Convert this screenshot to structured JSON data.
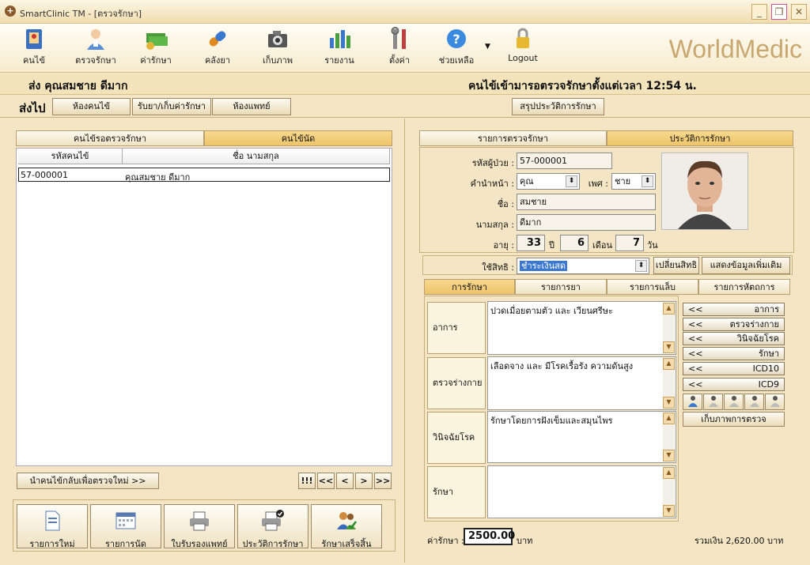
{
  "window": {
    "title": "SmartClinic TM - [ตรวจรักษา]"
  },
  "toolbar": {
    "items": [
      {
        "label": "คนไข้",
        "icon": "patient-book-icon"
      },
      {
        "label": "ตรวจรักษา",
        "icon": "doctor-icon"
      },
      {
        "label": "ค่ารักษา",
        "icon": "money-icon"
      },
      {
        "label": "คลังยา",
        "icon": "pill-icon"
      },
      {
        "label": "เก็บภาพ",
        "icon": "camera-icon"
      },
      {
        "label": "รายงาน",
        "icon": "bar-chart-icon"
      },
      {
        "label": "ตั้งค่า",
        "icon": "tools-icon"
      },
      {
        "label": "ช่วยเหลือ",
        "icon": "help-icon"
      },
      {
        "label": "Logout",
        "icon": "lock-icon"
      }
    ],
    "brand": "WorldMedic"
  },
  "status": {
    "patient": "ส่ง  คุณสมชาย ดีมาก",
    "since": "คนไข้เข้ามารอตรวจรักษาตั้งแต่เวลา 12:54 น."
  },
  "sendto": {
    "label": "ส่งไป",
    "buttons": [
      "ห้องคนไข้",
      "รับยา/เก็บค่ารักษา",
      "ห้องแพทย์"
    ],
    "summary": "สรุปประวัติการรักษา"
  },
  "left": {
    "tabs": [
      "คนไข้รอตรวจรักษา",
      "คนไข้นัด"
    ],
    "columns": [
      "รหัสคนไข้",
      "ชื่อ นามสกุล"
    ],
    "rows": [
      {
        "id": "57-000001",
        "name": "คุณสมชาย ดีมาก"
      }
    ],
    "return_button": "นำคนไข้กลับเพื่อตรวจใหม่ >>",
    "nav": [
      "!!!",
      "<<",
      "<",
      ">",
      ">>"
    ],
    "bottom_buttons": [
      {
        "label": "รายการใหม่",
        "icon": "new-document-icon"
      },
      {
        "label": "รายการนัด",
        "icon": "calendar-icon"
      },
      {
        "label": "ใบรับรองแพทย์",
        "icon": "printer-icon"
      },
      {
        "label": "ประวัติการรักษา",
        "icon": "printer-check-icon"
      },
      {
        "label": "รักษาเสร็จสิ้น",
        "icon": "users-check-icon"
      }
    ]
  },
  "right": {
    "tabs": [
      "รายการตรวจรักษา",
      "ประวัติการรักษา"
    ],
    "patient": {
      "id_label": "รหัสผู้ป่วย :",
      "id": "57-000001",
      "prefix_label": "คำนำหน้า :",
      "prefix": "คุณ",
      "gender_label": "เพศ :",
      "gender": "ชาย",
      "first_label": "ชื่อ :",
      "first": "สมชาย",
      "last_label": "นามสกุล :",
      "last": "ดีมาก",
      "age_label": "อายุ :",
      "age_years": "33",
      "years_unit": "ปี",
      "age_months": "6",
      "months_unit": "เดือน",
      "age_days": "7",
      "days_unit": "วัน"
    },
    "rights": {
      "label": "ใช้สิทธิ :",
      "value": "ชำระเงินสด",
      "change": "เปลี่ยนสิทธิ",
      "more": "แสดงข้อมูลเพิ่มเติม"
    },
    "subtabs": [
      "การรักษา",
      "รายการยา",
      "รายการแล็บ",
      "รายการหัตถการ"
    ],
    "records": [
      {
        "label": "อาการ",
        "text": "ปวดเมื่อยตามตัว และ เวียนศรีษะ"
      },
      {
        "label": "ตรวจร่างกาย",
        "text": "เลือดจาง และ มีโรคเรื้อรัง ความดันสูง"
      },
      {
        "label": "วินิจฉัยโรค",
        "text": "รักษาโดยการฝังเข็มและสมุนไพร"
      },
      {
        "label": "รักษา",
        "text": ""
      }
    ],
    "side_buttons": [
      "อาการ",
      "ตรวจร่างกาย",
      "วินิจฉัยโรค",
      "รักษา",
      "ICD10",
      "ICD9"
    ],
    "side_prefix": "<<",
    "capture_button": "เก็บภาพการตรวจ",
    "fee_label": "ค่ารักษา :",
    "fee": "2500.00",
    "fee_unit": "บาท",
    "total": "รวมเงิน 2,620.00 บาท"
  }
}
